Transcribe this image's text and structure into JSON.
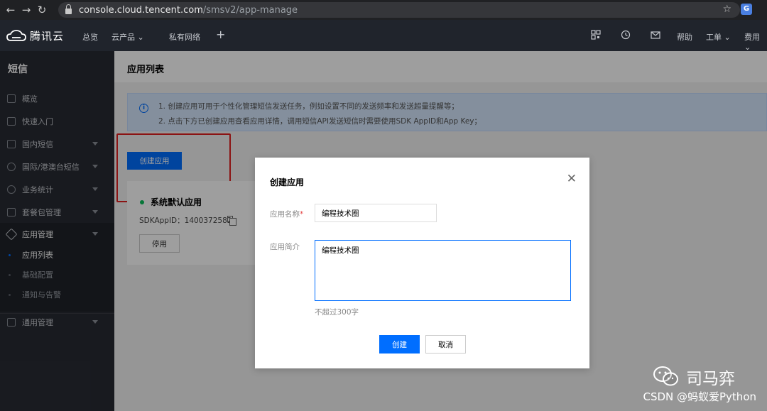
{
  "browser": {
    "url_host": "console.cloud.tencent.com",
    "url_path": "/smsv2/app-manage",
    "back_icon": "←",
    "forward_icon": "→",
    "reload_icon": "↻",
    "star_icon": "☆"
  },
  "topnav": {
    "brand": "腾讯云",
    "items": [
      "总览",
      "云产品 ⌄",
      "私有网络"
    ],
    "plus": "+",
    "right": [
      "帮助",
      "工单 ⌄",
      "费用 ⌄"
    ]
  },
  "sidebar": {
    "title": "短信",
    "items": [
      {
        "label": "概览",
        "icon": "grid-icon"
      },
      {
        "label": "快速入门",
        "icon": "book-icon"
      },
      {
        "label": "国内短信",
        "icon": "mail-icon"
      },
      {
        "label": "国际/港澳台短信",
        "icon": "globe-icon"
      },
      {
        "label": "业务统计",
        "icon": "pie-icon"
      },
      {
        "label": "套餐包管理",
        "icon": "package-icon"
      },
      {
        "label": "应用管理",
        "icon": "layers-icon"
      }
    ],
    "sub_items": [
      {
        "label": "应用列表",
        "active": true
      },
      {
        "label": "基础配置",
        "active": false
      },
      {
        "label": "通知与告警",
        "active": false
      }
    ],
    "bottom_item": {
      "label": "通用管理",
      "icon": "settings-icon"
    }
  },
  "main": {
    "page_title": "应用列表",
    "info_lines": [
      "1. 创建应用可用于个性化管理短信发送任务，例如设置不同的发送频率和发送超量提醒等；",
      "2. 点击下方已创建应用查看应用详情，调用短信API发送短信时需要使用SDK AppID和App Key；"
    ],
    "create_button": "创建应用",
    "app_card": {
      "name": "系统默认应用",
      "sdk_appid": "SDKAppID：1400372582",
      "disable_button": "停用"
    }
  },
  "modal": {
    "title": "创建应用",
    "close": "✕",
    "name_label": "应用名称",
    "name_required": "*",
    "name_value": "编程技术圈",
    "desc_label": "应用简介",
    "desc_value": "编程技术圈",
    "hint": "不超过300字",
    "create_button": "创建",
    "cancel_button": "取消"
  },
  "watermark": {
    "name": "司马弈",
    "csdn": "CSDN @蚂蚁爱Python"
  },
  "colors": {
    "accent": "#006eff",
    "highlight": "#e02020",
    "sidebar_bg": "#282b33",
    "topnav_bg": "#20242c"
  }
}
